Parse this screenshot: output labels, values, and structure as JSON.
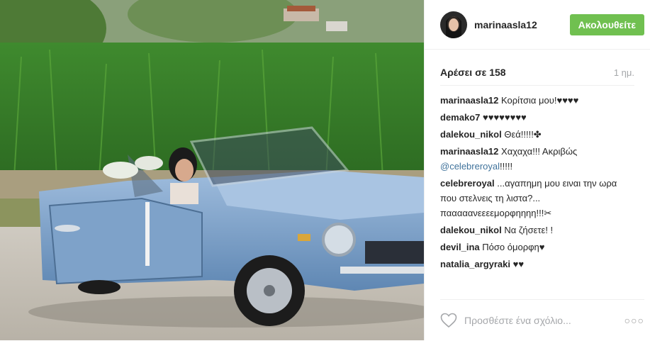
{
  "post": {
    "username": "marinaasla12",
    "follow_label": "Ακολουθείτε",
    "likes_label": "Αρέσει σε 158",
    "time": "1 ημ.",
    "add_comment_placeholder": "Προσθέστε ένα σχόλιο...",
    "more_label": "○○○",
    "photo_alt": "photo"
  },
  "comments": [
    {
      "user": "marinaasla12",
      "text": "Κορίτσια μου!♥♥♥♥"
    },
    {
      "user": "demako7",
      "text": "♥♥♥♥♥♥♥♥"
    },
    {
      "user": "dalekou_nikol",
      "text": "Θεά!!!!!✤"
    },
    {
      "user": "marinaasla12",
      "text": "Χαχαχα!!! Ακριβώς",
      "mention": "@celebreroyal",
      "after": "!!!!!"
    },
    {
      "user": "celebreroyal",
      "text": "...αγαπημη μου ειναι την ωρα που στελνεις τη λιστα?... πααααανεεεεμορφηηηη!!!✂"
    },
    {
      "user": "dalekou_nikol",
      "text": "Να ζήσετε! !"
    },
    {
      "user": "devil_ina",
      "text": "Πόσο όμορφη♥"
    },
    {
      "user": "natalia_argyraki",
      "text": "♥♥"
    }
  ],
  "colors": {
    "follow_bg": "#70c050",
    "mention": "#3f729b",
    "car_body": "#7fa3c9"
  },
  "icons": {
    "like": "heart-outline-icon",
    "more": "ellipsis-icon"
  }
}
